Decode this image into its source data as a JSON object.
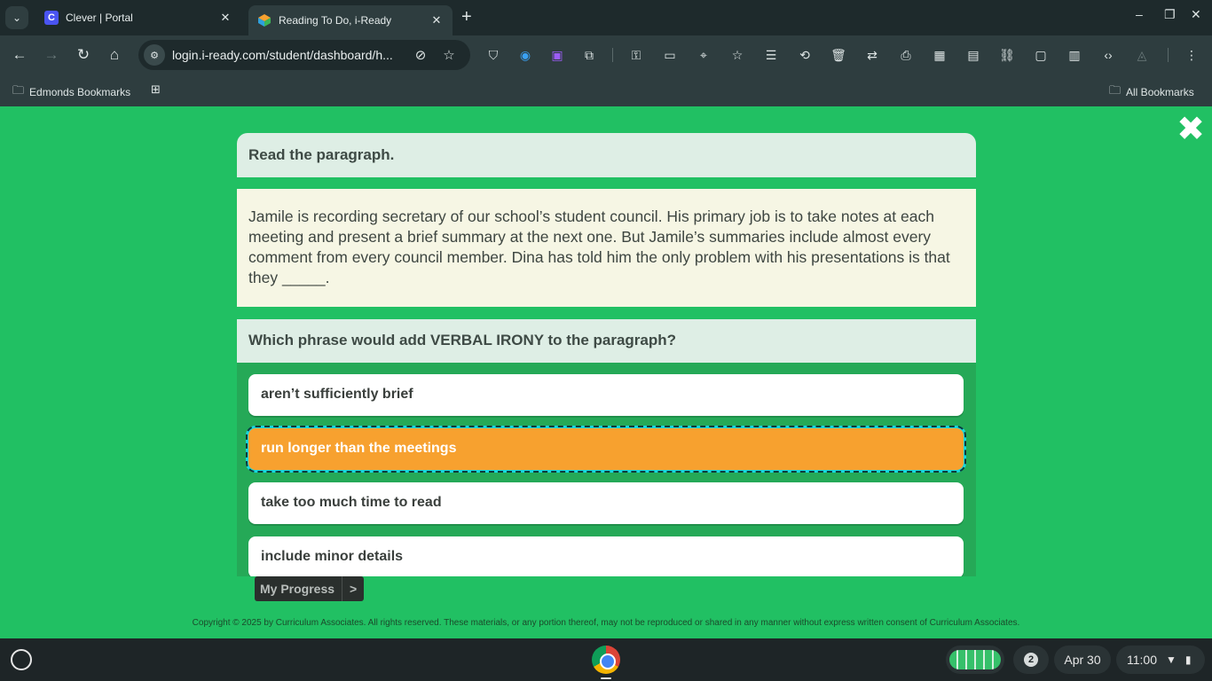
{
  "browser": {
    "tabs": [
      {
        "title": "Clever | Portal",
        "favicon": "C",
        "favicon_color": "#4a54f1"
      },
      {
        "title": "Reading To Do, i-Ready",
        "favicon": "",
        "favicon_color": "#f7a12f"
      }
    ],
    "url": "login.i-ready.com/student/dashboard/h...",
    "bookmarks_bar": {
      "left_folder": "Edmonds Bookmarks",
      "right_folder": "All Bookmarks"
    }
  },
  "lesson": {
    "instruction": "Read the paragraph.",
    "passage": "Jamile is recording secretary of our school’s student council. His primary job is to take notes at each meeting and present a brief summary at the next one. But Jamile’s summaries include almost every comment from every council member. Dina has told him the only problem with his presentations is that they _____.",
    "question": "Which phrase would add VERBAL IRONY to the paragraph?",
    "answers": [
      {
        "label": "aren’t sufficiently brief",
        "selected": false
      },
      {
        "label": "run longer than the meetings",
        "selected": true
      },
      {
        "label": "take too much time to read",
        "selected": false
      },
      {
        "label": "include minor details",
        "selected": false
      }
    ],
    "progress_label": "My Progress",
    "progress_arrow": ">",
    "copyright": "Copyright © 2025 by Curriculum Associates. All rights reserved. These materials, or any portion thereof, may not be reproduced or shared in any manner without express written consent of Curriculum Associates."
  },
  "colors": {
    "page_bg": "#21c063",
    "selected_answer": "#f7a12f",
    "answers_bg": "#25a957"
  },
  "shelf": {
    "notification_count": "2",
    "date": "Apr 30",
    "time": "11:00"
  }
}
